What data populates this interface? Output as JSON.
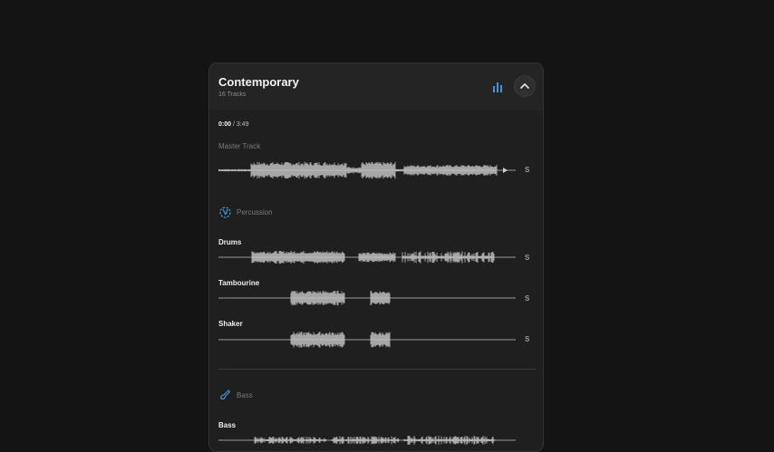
{
  "header": {
    "title": "Contemporary",
    "subtitle": "16 Tracks",
    "chart_icon": "bar-chart-icon",
    "collapse_icon": "chevron-up-icon"
  },
  "playback": {
    "current": "0:00",
    "separator": "/",
    "total": "3:49"
  },
  "master": {
    "label": "Master Track",
    "solo": "S"
  },
  "groups": [
    {
      "name": "Percussion",
      "icon": "percussion-icon",
      "tracks": [
        {
          "name": "Drums",
          "solo": "S"
        },
        {
          "name": "Tambourine",
          "solo": "S"
        },
        {
          "name": "Shaker",
          "solo": "S"
        }
      ]
    },
    {
      "name": "Bass",
      "icon": "bass-guitar-icon",
      "tracks": [
        {
          "name": "Bass",
          "solo": "S"
        }
      ]
    }
  ],
  "colors": {
    "accent": "#4a90d9",
    "waveform": "#c8c8c8",
    "background": "#141414",
    "panel": "#1f1f1f"
  }
}
